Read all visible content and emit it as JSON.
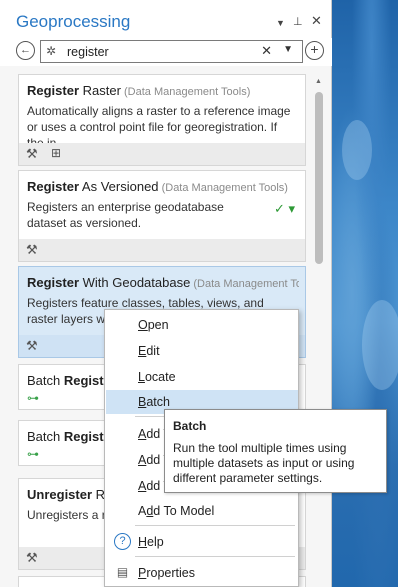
{
  "pane": {
    "title": "Geoprocessing",
    "controls": {
      "menu": "▼",
      "pin": "📌",
      "close": "✕"
    }
  },
  "search": {
    "value": "register",
    "back_icon": "←",
    "add_icon": "+",
    "search_icon": "✲",
    "clear_icon": "✕",
    "dropdown_icon": "▼"
  },
  "tools": [
    {
      "bold": "Register",
      "name": " Raster",
      "group": " (Data Management Tools)",
      "desc": "Automatically aligns a raster to a reference image or uses a control point file for georegistration. If the in..."
    },
    {
      "bold": "Register",
      "name": " As Versioned",
      "group": " (Data Management Tools)",
      "desc": "Registers an enterprise geodatabase dataset as versioned."
    },
    {
      "bold": "Register",
      "name": " With Geodatabase",
      "group": " (Data Management To...",
      "desc": "Registers feature classes, tables, views, and raster layers with the"
    },
    {
      "prefix": "Batch ",
      "bold": "Regist",
      "name": "",
      "group": "",
      "desc": ""
    },
    {
      "prefix": "Batch ",
      "bold": "Regist",
      "name": "",
      "group": "",
      "desc": ""
    },
    {
      "prefix": "Un",
      "bold": "register",
      "name": " R",
      "group": "",
      "desc": "Unregisters a r"
    }
  ],
  "context_menu": {
    "items": [
      {
        "pre": "",
        "u": "O",
        "post": "pen"
      },
      {
        "pre": "",
        "u": "E",
        "post": "dit"
      },
      {
        "pre": "",
        "u": "L",
        "post": "ocate"
      },
      {
        "pre": "",
        "u": "B",
        "post": "atch"
      },
      {
        "pre": "",
        "u": "A",
        "post": "dd T"
      },
      {
        "pre": "",
        "u": "A",
        "post": "dd T"
      },
      {
        "pre": "",
        "u": "A",
        "post": "dd T"
      },
      {
        "pre": "A",
        "u": "d",
        "post": "d To Model"
      },
      {
        "pre": "",
        "u": "H",
        "post": "elp"
      },
      {
        "pre": "",
        "u": "P",
        "post": "roperties"
      }
    ]
  },
  "tooltip": {
    "title": "Batch",
    "text": "Run the tool multiple times using multiple datasets as input or using different parameter settings."
  }
}
